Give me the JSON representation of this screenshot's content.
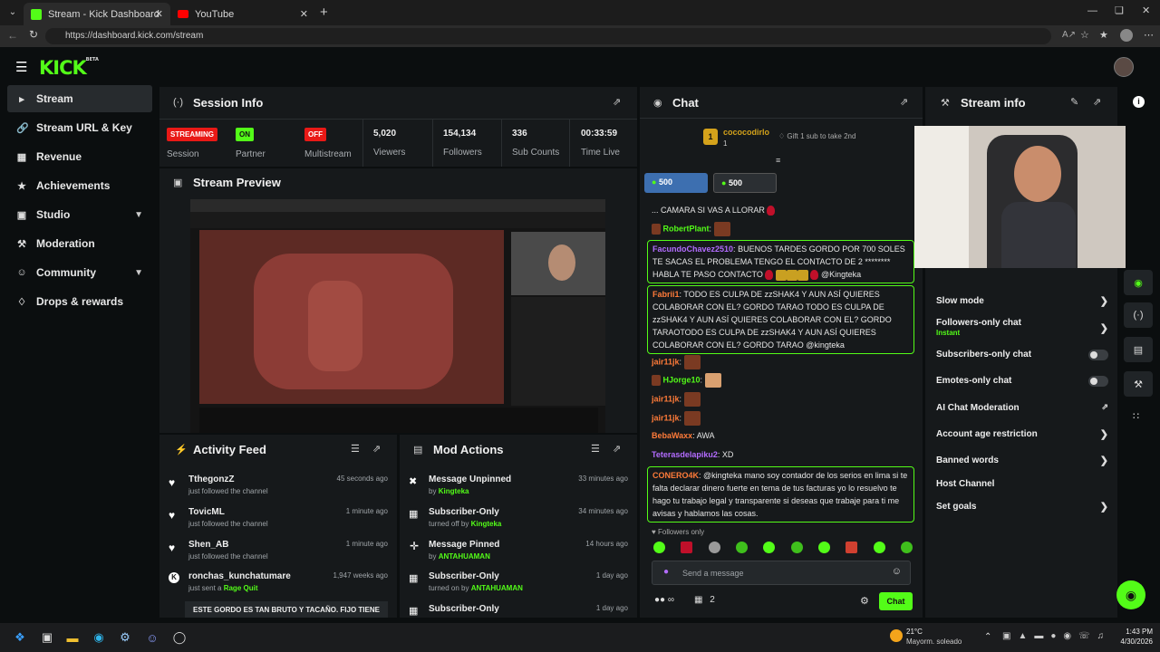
{
  "browser": {
    "tabs": [
      {
        "label": "Stream - Kick Dashboard",
        "icon": "kick-favicon"
      },
      {
        "label": "YouTube",
        "icon": "youtube-favicon"
      }
    ],
    "url": "https://dashboard.kick.com/stream"
  },
  "brand": {
    "logo": "KICK",
    "beta": "BETA",
    "accent": "#53fc18"
  },
  "sidebar": {
    "items": [
      {
        "label": "Stream",
        "icon": "stream-icon",
        "active": true
      },
      {
        "label": "Stream URL & Key",
        "icon": "link-icon"
      },
      {
        "label": "Revenue",
        "icon": "revenue-icon"
      },
      {
        "label": "Achievements",
        "icon": "trophy-icon"
      },
      {
        "label": "Studio",
        "icon": "studio-icon",
        "expandable": true
      },
      {
        "label": "Moderation",
        "icon": "wrench-icon"
      },
      {
        "label": "Community",
        "icon": "users-icon",
        "expandable": true
      },
      {
        "label": "Drops & rewards",
        "icon": "gift-icon"
      }
    ]
  },
  "session": {
    "title": "Session Info",
    "badges": [
      {
        "text": "STREAMING",
        "label": "Session",
        "color": "#e91916"
      },
      {
        "text": "ON",
        "label": "Partner",
        "color": "#53fc18"
      },
      {
        "text": "OFF",
        "label": "Multistream",
        "color": "#e91916"
      }
    ],
    "stats": [
      {
        "value": "5,020",
        "label": "Viewers"
      },
      {
        "value": "154,134",
        "label": "Followers"
      },
      {
        "value": "336",
        "label": "Sub Counts"
      },
      {
        "value": "00:33:59",
        "label": "Time Live"
      }
    ]
  },
  "preview": {
    "title": "Stream Preview"
  },
  "activity": {
    "title": "Activity Feed",
    "items": [
      {
        "name": "TthegonzZ",
        "text": "just followed the channel",
        "time": "45 seconds ago"
      },
      {
        "name": "TovicML",
        "text": "just followed the channel",
        "time": "1 minute ago"
      },
      {
        "name": "Shen_AB",
        "text": "just followed the channel",
        "time": "1 minute ago"
      },
      {
        "name": "ronchas_kunchatumare",
        "text": "just sent a",
        "extra": "Rage Quit",
        "time": "1,947 weeks ago"
      }
    ],
    "banner": "ESTE GORDO ES TAN BRUTO Y TACAÑO. FIJO TIENE"
  },
  "mod": {
    "title": "Mod Actions",
    "items": [
      {
        "action": "Message Unpinned",
        "pre": "by",
        "by": "Kingteka",
        "time": "33 minutes ago"
      },
      {
        "action": "Subscriber-Only",
        "pre": "turned off by",
        "by": "Kingteka",
        "time": "34 minutes ago"
      },
      {
        "action": "Message Pinned",
        "pre": "by",
        "by": "ANTAHUAMAN",
        "time": "14 hours ago"
      },
      {
        "action": "Subscriber-Only",
        "pre": "turned on by",
        "by": "ANTAHUAMAN",
        "time": "1 day ago"
      },
      {
        "action": "Subscriber-Only",
        "pre": "",
        "by": "",
        "time": "1 day ago"
      }
    ]
  },
  "chat": {
    "title": "Chat",
    "pinned": {
      "rank": "1",
      "user": "cococodirlo",
      "count": "1",
      "gift": "Gift 1 sub to take 2nd"
    },
    "kicks": [
      "500",
      "500"
    ],
    "partial": "... CAMARA SI VAS A LLORAR",
    "messages": [
      {
        "user": "RobertPlant",
        "color": "#53fc18",
        "text": ""
      },
      {
        "user": "FacundoChavez2510",
        "color": "#b36cff",
        "text": "BUENOS TARDES GORDO POR 700 SOLES TE SACAS EL PROBLEMA TENGO EL CONTACTO DE 2 ******** HABLA TE PASO CONTACTO",
        "tail": "@Kingteka",
        "highlight": true
      },
      {
        "user": "Fabrii1",
        "color": "#ff7b39",
        "text": "TODO ES CULPA DE zzSHAK4 Y AUN ASÍ QUIERES COLABORAR CON EL? GORDO TARAO TODO ES CULPA DE zzSHAK4 Y AUN ASÍ QUIERES COLABORAR CON EL? GORDO TARAOTODO ES CULPA DE zzSHAK4 Y AUN ASÍ QUIERES COLABORAR CON EL? GORDO TARAO @kingteka",
        "highlight": true
      },
      {
        "user": "jair11jk",
        "color": "#ff7b39",
        "text": ""
      },
      {
        "user": "HJorge10",
        "color": "#53fc18",
        "text": ""
      },
      {
        "user": "jair11jk",
        "color": "#ff7b39",
        "text": ""
      },
      {
        "user": "jair11jk",
        "color": "#ff7b39",
        "text": ""
      },
      {
        "user": "BebaWaxx",
        "color": "#ff7b39",
        "text": "AWA"
      },
      {
        "user": "Teterasdelapiku2",
        "color": "#b36cff",
        "text": "XD"
      },
      {
        "user": "CONERO4K",
        "color": "#ff7b39",
        "text": "@kingteka mano soy contador de los serios en lima si te falta declarar dinero fuerte en tema de tus facturas yo lo resuelvo te hago tu trabajo legal y transparente si deseas que trabaje para ti me avisas y hablamos las cosas.",
        "highlight": true
      }
    ],
    "followers_only": "Followers only",
    "placeholder": "Send a message",
    "viewers_icon": "∞",
    "count": "2",
    "send": "Chat"
  },
  "stream_info": {
    "title": "Stream info",
    "settings": [
      {
        "label": "Slow mode",
        "type": "chevron"
      },
      {
        "label": "Followers-only chat",
        "sub": "Instant",
        "type": "chevron"
      },
      {
        "label": "Subscribers-only chat",
        "type": "toggle"
      },
      {
        "label": "Emotes-only chat",
        "type": "toggle"
      },
      {
        "label": "AI Chat Moderation",
        "type": "external"
      },
      {
        "label": "Account age restriction",
        "type": "chevron"
      },
      {
        "label": "Banned words",
        "type": "chevron"
      },
      {
        "label": "Host Channel",
        "type": "none"
      },
      {
        "label": "Set goals",
        "type": "chevron"
      }
    ]
  },
  "taskbar": {
    "weather_temp": "21°C",
    "weather_text": "Mayorm. soleado",
    "time": "1:43 PM",
    "date": "4/30/2026"
  }
}
